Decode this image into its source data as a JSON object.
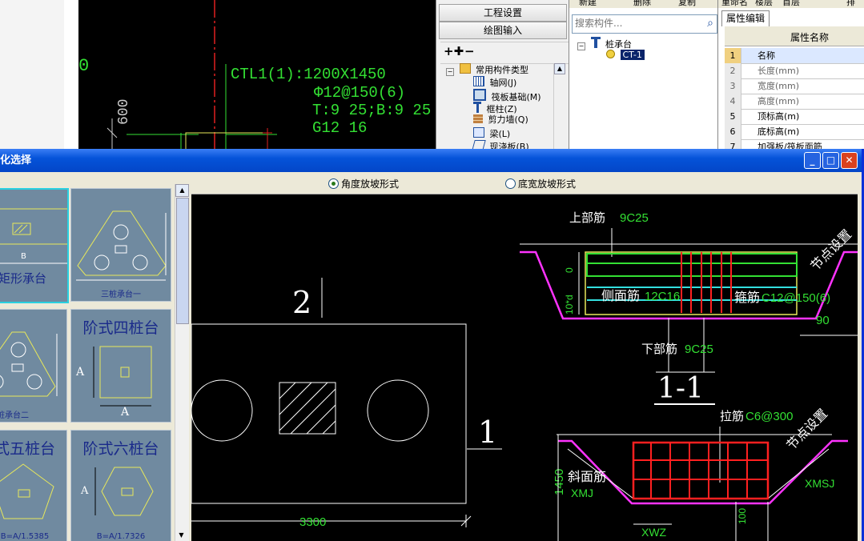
{
  "cad_top": {
    "axis_label": "0",
    "dimension_left": "600",
    "annotation": [
      "CTL1(1):1200X1450",
      "Φ12@150(6)",
      "T:9 25;B:9 25",
      "G12 16"
    ]
  },
  "nav": {
    "buttons": [
      "工程设置",
      "绘图输入"
    ],
    "tree_root": "常用构件类型",
    "tree_items": [
      "轴网(J)",
      "筏板基础(M)",
      "框柱(Z)",
      "剪力墙(Q)",
      "梁(L)",
      "现浇板(B)"
    ]
  },
  "component": {
    "search_placeholder": "搜索构件...",
    "tree_root": "桩承台",
    "selected_item": "CT-1"
  },
  "toolbar_partial": [
    "新建",
    "删除",
    "复制",
    "重命名",
    "楼层",
    "首层",
    "排"
  ],
  "properties": {
    "tab": "属性编辑",
    "column_header": "属性名称",
    "rows": [
      {
        "num": "1",
        "name": "名称"
      },
      {
        "num": "2",
        "name": "长度(mm)"
      },
      {
        "num": "3",
        "name": "宽度(mm)"
      },
      {
        "num": "4",
        "name": "高度(mm)"
      },
      {
        "num": "5",
        "name": "顶标高(m)"
      },
      {
        "num": "6",
        "name": "底标高(m)"
      },
      {
        "num": "7",
        "name": "加强板/筏板面筋"
      }
    ]
  },
  "dialog": {
    "title": "化选择",
    "options": [
      {
        "label": "角度放坡形式",
        "selected": true
      },
      {
        "label": "底宽放坡形式",
        "selected": false
      }
    ],
    "thumbnails": [
      {
        "title": "",
        "caption": "矩形承台",
        "dims": [
          "B"
        ]
      },
      {
        "title": "",
        "caption": "三桩承台一",
        "dims": []
      },
      {
        "title": "",
        "caption": "三桩承台二",
        "dims": []
      },
      {
        "title": "阶式四桩台",
        "caption": "",
        "dims": [
          "A",
          "A"
        ]
      },
      {
        "title": "式五桩台",
        "caption": "B=A/1.5385",
        "dims": []
      },
      {
        "title": "阶式六桩台",
        "caption": "B=A/1.7326",
        "dims": [
          "A"
        ]
      }
    ]
  },
  "drawing": {
    "plan_label_2": "2",
    "plan_label_1": "1",
    "plan_width": "3300",
    "section_top": {
      "top_bar_label": "上部筋",
      "top_bar_value": "9C25",
      "node_setting": "节点设置",
      "side_bar_label": "侧面筋",
      "side_bar_value": "12C16",
      "stirrup_label": "箍筋",
      "stirrup_value": "C12@150(6)",
      "bottom_bar_label": "下部筋",
      "bottom_bar_value": "9C25",
      "angle": "90",
      "dim_0": "0",
      "dim_10d": "10*d"
    },
    "section_title": "1-1",
    "section_bottom": {
      "tie_label": "拉筋",
      "tie_value": "C6@300",
      "node_setting": "节点设置",
      "slope_label": "斜面筋",
      "xmj": "XMJ",
      "xmsj": "XMSJ",
      "xwz": "XWZ",
      "height": "1450",
      "dim_100": "100"
    }
  },
  "colors": {
    "cad_green": "#33e033",
    "dialog_blue": "#0553d9",
    "magenta": "#ff33ff",
    "rebar_red": "#ff2020",
    "cyan": "#33e0e0",
    "yellow": "#e8e85a"
  }
}
